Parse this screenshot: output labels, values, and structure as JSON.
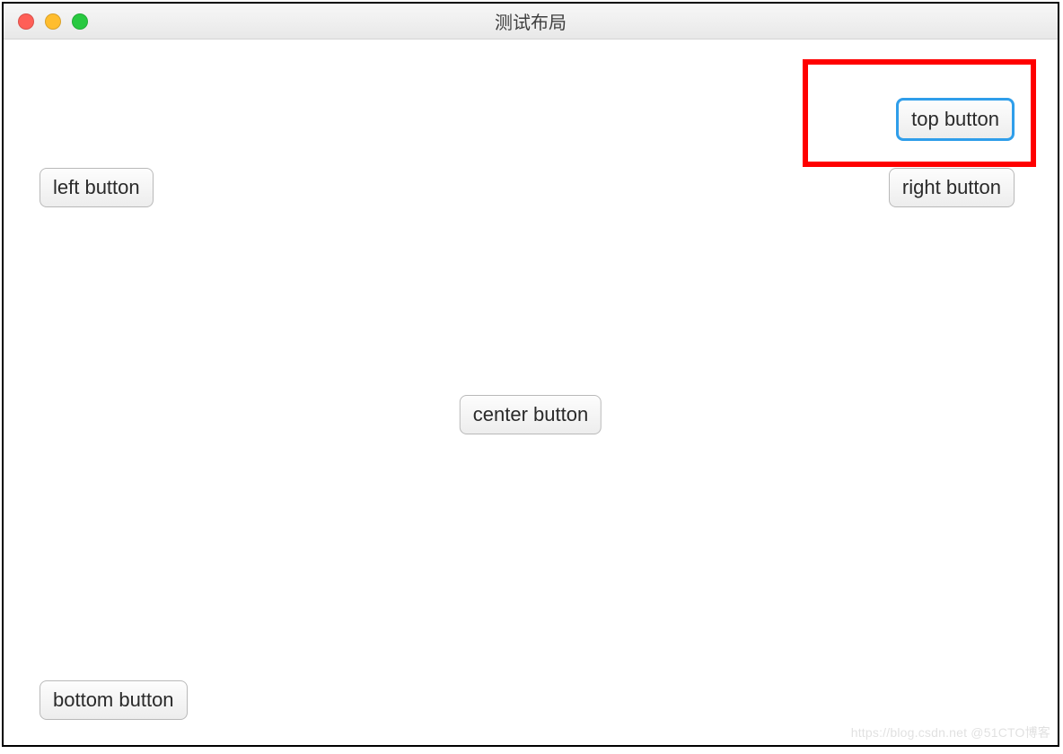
{
  "window": {
    "title": "测试布局"
  },
  "buttons": {
    "top": "top button",
    "left": "left button",
    "right": "right button",
    "center": "center button",
    "bottom": "bottom button"
  },
  "highlight": {
    "color": "#ff0000"
  },
  "watermark": "https://blog.csdn.net @51CTO博客"
}
